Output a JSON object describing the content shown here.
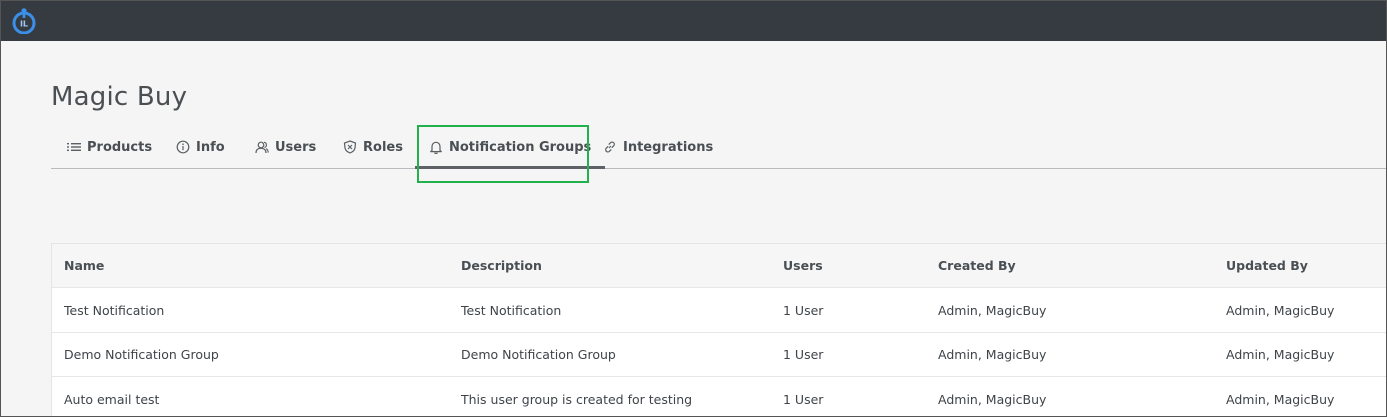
{
  "app": {
    "logo_text": "IL",
    "page_title": "Magic Buy"
  },
  "tabs": [
    {
      "label": "Products",
      "icon": "list-icon",
      "active": false
    },
    {
      "label": "Info",
      "icon": "info-icon",
      "active": false
    },
    {
      "label": "Users",
      "icon": "users-icon",
      "active": false
    },
    {
      "label": "Roles",
      "icon": "shield-icon",
      "active": false
    },
    {
      "label": "Notification Groups",
      "icon": "bell-icon",
      "active": true
    },
    {
      "label": "Integrations",
      "icon": "link-icon",
      "active": false
    }
  ],
  "table": {
    "columns": [
      "Name",
      "Description",
      "Users",
      "Created By",
      "Updated By"
    ],
    "rows": [
      [
        "Test Notification",
        "Test Notification",
        "1 User",
        "Admin, MagicBuy",
        "Admin, MagicBuy"
      ],
      [
        "Demo Notification Group",
        "Demo Notification Group",
        "1 User",
        "Admin, MagicBuy",
        "Admin, MagicBuy"
      ],
      [
        "Auto email test",
        "This user group is created for testing",
        "1 User",
        "Admin, MagicBuy",
        "Admin, MagicBuy"
      ]
    ]
  },
  "colors": {
    "topbar": "#363b42",
    "highlight": "#22b14c",
    "logo_accent": "#3b8fe8"
  }
}
